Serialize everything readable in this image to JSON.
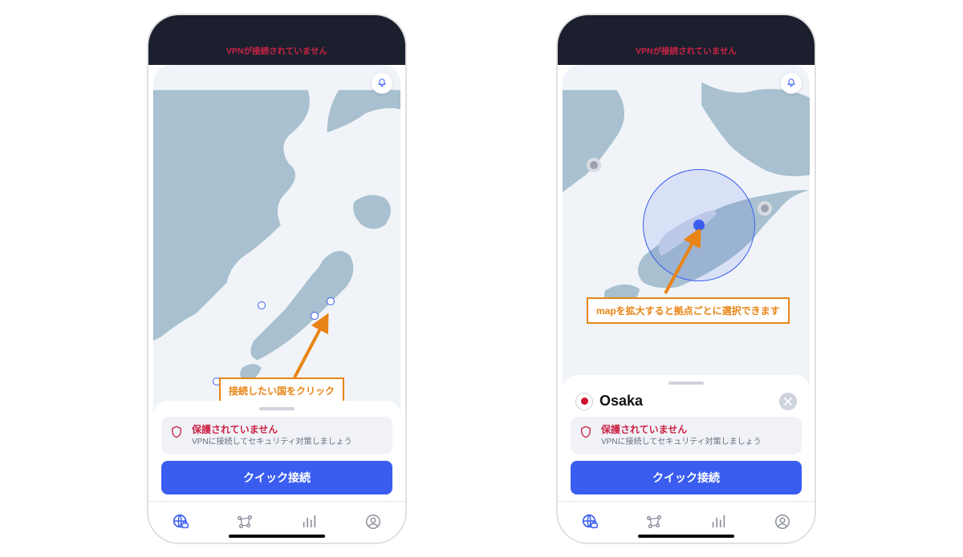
{
  "status": {
    "time": "",
    "indicators": ""
  },
  "header": {
    "vpn_status": "VPNが接続されていません"
  },
  "callouts": {
    "left": "接続したい国をクリック",
    "right": "mapを拡大すると拠点ごとに選択できます"
  },
  "protect": {
    "title": "保護されていません",
    "subtitle": "VPNに接続してセキュリティ対策しましょう"
  },
  "quick_connect": "クイック接続",
  "selected_location": {
    "name": "Osaka"
  },
  "colors": {
    "accent": "#3a5df0",
    "warning": "#cc2344",
    "callout": "#e88415"
  }
}
